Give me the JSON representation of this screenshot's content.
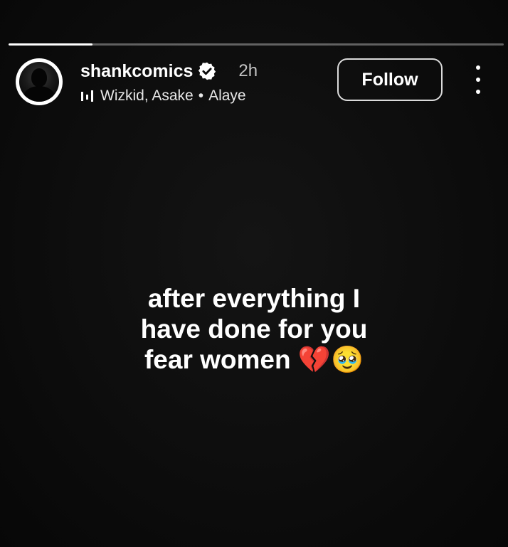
{
  "story": {
    "progress": 0.17,
    "colors": {
      "background": "#0b0b0b",
      "text": "#ffffff"
    }
  },
  "header": {
    "username": "shankcomics",
    "verified": true,
    "time": "2h",
    "music": {
      "icon": "music-bars-icon",
      "artists": "Wizkid, Asake",
      "separator": "•",
      "song": "Alaye"
    },
    "follow_label": "Follow",
    "more_icon": "vertical-dots-icon"
  },
  "caption": {
    "line1": "after everything I",
    "line2": "have done for you",
    "line3": "fear women",
    "emoji1": "💔",
    "emoji2": "🥹"
  }
}
